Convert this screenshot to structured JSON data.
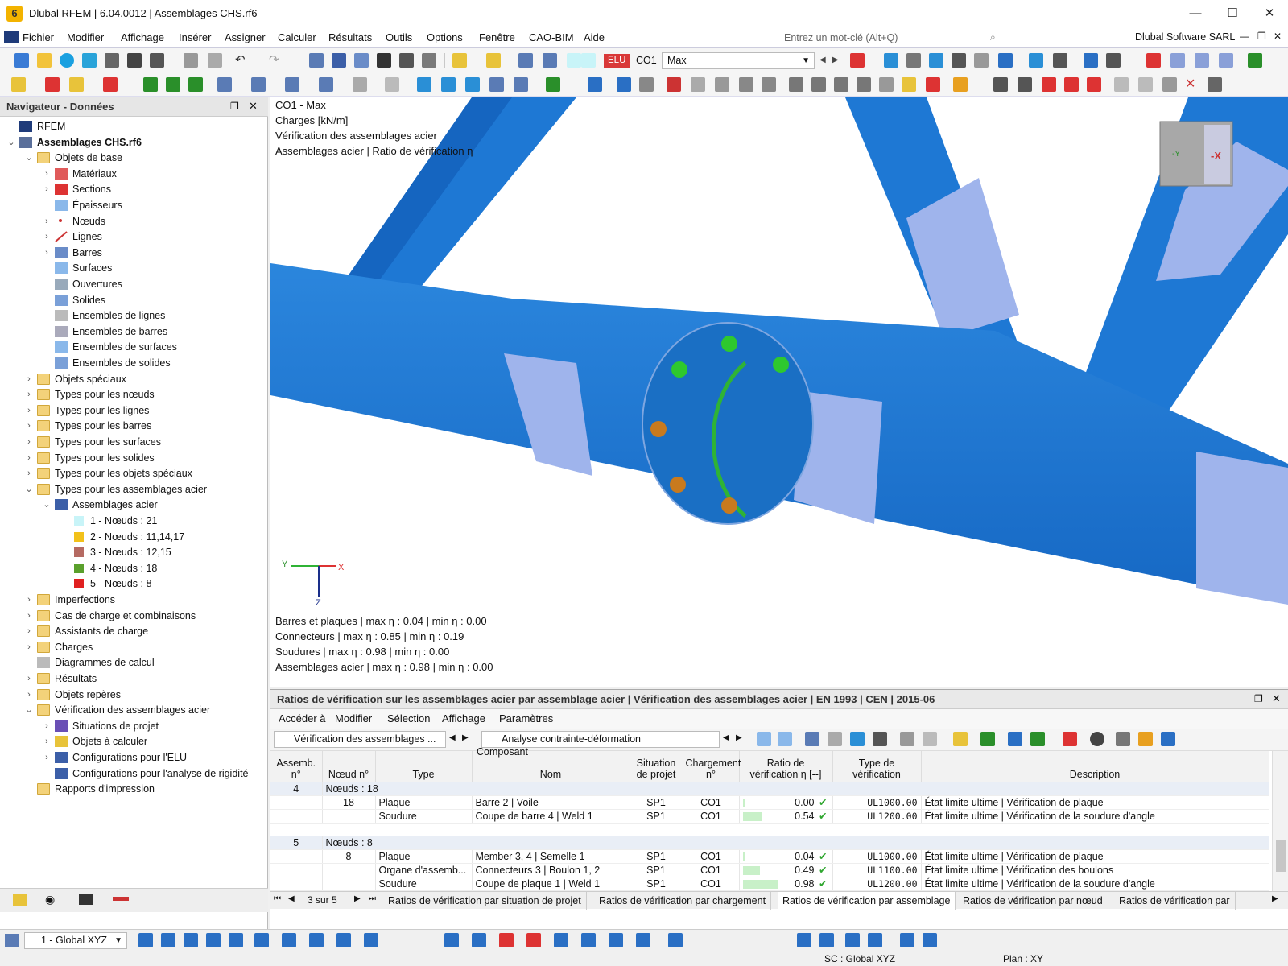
{
  "window": {
    "title": "Dlubal RFEM | 6.04.0012 | Assemblages CHS.rf6",
    "minimize": "—",
    "maximize": "☐",
    "close": "✕"
  },
  "menu": {
    "items": [
      "Fichier",
      "Modifier",
      "Affichage",
      "Insérer",
      "Assigner",
      "Calculer",
      "Résultats",
      "Outils",
      "Options",
      "Fenêtre",
      "CAO-BIM",
      "Aide"
    ],
    "search_placeholder": "Entrez un mot-clé (Alt+Q)",
    "company": "Dlubal Software SARL"
  },
  "toolbar": {
    "elu_badge": "ELU",
    "co_label": "CO1",
    "combo_value": "Max"
  },
  "navigator": {
    "title": "Navigateur - Données",
    "items": [
      {
        "label": "RFEM",
        "level": 0,
        "arrow": "",
        "icon": "rfem-icon"
      },
      {
        "label": "Assemblages CHS.rf6",
        "level": 0,
        "arrow": "▾",
        "icon": "model-icon",
        "bold": true
      },
      {
        "label": "Objets de base",
        "level": 1,
        "arrow": "▾",
        "icon": "folder-icon"
      },
      {
        "label": "Matériaux",
        "level": 2,
        "arrow": "›",
        "icon": "materials-icon"
      },
      {
        "label": "Sections",
        "level": 2,
        "arrow": "›",
        "icon": "sections-icon"
      },
      {
        "label": "Épaisseurs",
        "level": 2,
        "arrow": "",
        "icon": "thickness-icon"
      },
      {
        "label": "Nœuds",
        "level": 2,
        "arrow": "›",
        "icon": "node-icon"
      },
      {
        "label": "Lignes",
        "level": 2,
        "arrow": "›",
        "icon": "line-icon"
      },
      {
        "label": "Barres",
        "level": 2,
        "arrow": "›",
        "icon": "member-icon"
      },
      {
        "label": "Surfaces",
        "level": 2,
        "arrow": "",
        "icon": "surface-icon"
      },
      {
        "label": "Ouvertures",
        "level": 2,
        "arrow": "",
        "icon": "opening-icon"
      },
      {
        "label": "Solides",
        "level": 2,
        "arrow": "",
        "icon": "solid-icon"
      },
      {
        "label": "Ensembles de lignes",
        "level": 2,
        "arrow": "",
        "icon": "line-set-icon"
      },
      {
        "label": "Ensembles de barres",
        "level": 2,
        "arrow": "",
        "icon": "member-set-icon"
      },
      {
        "label": "Ensembles de surfaces",
        "level": 2,
        "arrow": "",
        "icon": "surface-set-icon"
      },
      {
        "label": "Ensembles de solides",
        "level": 2,
        "arrow": "",
        "icon": "solid-set-icon"
      },
      {
        "label": "Objets spéciaux",
        "level": 1,
        "arrow": "›",
        "icon": "folder-icon"
      },
      {
        "label": "Types pour les nœuds",
        "level": 1,
        "arrow": "›",
        "icon": "folder-icon"
      },
      {
        "label": "Types pour les lignes",
        "level": 1,
        "arrow": "›",
        "icon": "folder-icon"
      },
      {
        "label": "Types pour les barres",
        "level": 1,
        "arrow": "›",
        "icon": "folder-icon"
      },
      {
        "label": "Types pour les surfaces",
        "level": 1,
        "arrow": "›",
        "icon": "folder-icon"
      },
      {
        "label": "Types pour les solides",
        "level": 1,
        "arrow": "›",
        "icon": "folder-icon"
      },
      {
        "label": "Types pour les objets spéciaux",
        "level": 1,
        "arrow": "›",
        "icon": "folder-icon"
      },
      {
        "label": "Types pour les assemblages acier",
        "level": 1,
        "arrow": "▾",
        "icon": "folder-icon"
      },
      {
        "label": "Assemblages acier",
        "level": 2,
        "arrow": "▾",
        "icon": "steel-joint-icon"
      },
      {
        "label": "1 - Nœuds : 21",
        "level": 3,
        "arrow": "",
        "icon": "swatch",
        "color": "#c8f4f8"
      },
      {
        "label": "2 - Nœuds : 11,14,17",
        "level": 3,
        "arrow": "",
        "icon": "swatch",
        "color": "#f2c11a"
      },
      {
        "label": "3 - Nœuds : 12,15",
        "level": 3,
        "arrow": "",
        "icon": "swatch",
        "color": "#b56a62"
      },
      {
        "label": "4 - Nœuds : 18",
        "level": 3,
        "arrow": "",
        "icon": "swatch",
        "color": "#5aa02c"
      },
      {
        "label": "5 - Nœuds : 8",
        "level": 3,
        "arrow": "",
        "icon": "swatch",
        "color": "#e02020"
      },
      {
        "label": "Imperfections",
        "level": 1,
        "arrow": "›",
        "icon": "folder-icon"
      },
      {
        "label": "Cas de charge et combinaisons",
        "level": 1,
        "arrow": "›",
        "icon": "folder-icon"
      },
      {
        "label": "Assistants de charge",
        "level": 1,
        "arrow": "›",
        "icon": "folder-icon"
      },
      {
        "label": "Charges",
        "level": 1,
        "arrow": "›",
        "icon": "folder-icon"
      },
      {
        "label": "Diagrammes de calcul",
        "level": 1,
        "arrow": "",
        "icon": "diagram-icon"
      },
      {
        "label": "Résultats",
        "level": 1,
        "arrow": "›",
        "icon": "folder-icon"
      },
      {
        "label": "Objets repères",
        "level": 1,
        "arrow": "›",
        "icon": "folder-icon"
      },
      {
        "label": "Vérification des assemblages acier",
        "level": 1,
        "arrow": "▾",
        "icon": "folder-icon"
      },
      {
        "label": "Situations de projet",
        "level": 2,
        "arrow": "›",
        "icon": "design-situation-icon"
      },
      {
        "label": "Objets à calculer",
        "level": 2,
        "arrow": "›",
        "icon": "objects-icon"
      },
      {
        "label": "Configurations pour l'ELU",
        "level": 2,
        "arrow": "›",
        "icon": "config-icon"
      },
      {
        "label": "Configurations pour l'analyse de rigidité",
        "level": 2,
        "arrow": "",
        "icon": "config-icon"
      },
      {
        "label": "Rapports d'impression",
        "level": 1,
        "arrow": "",
        "icon": "folder-icon"
      }
    ]
  },
  "viewport": {
    "info_lines": [
      "CO1 - Max",
      "Charges [kN/m]",
      "Vérification des assemblages acier",
      "Assemblages acier | Ratio de vérification η"
    ],
    "summary_lines": [
      "Barres et plaques | max η : 0.04 | min η : 0.00",
      "Connecteurs | max η : 0.85 | min η : 0.19",
      "Soudures | max η : 0.98 | min η : 0.00",
      "Assemblages acier | max η : 0.98 | min η : 0.00"
    ],
    "axis_y": "Y",
    "axis_x": "X",
    "axis_z": "Z",
    "cube_y": "-Y",
    "cube_x": "-X",
    "colors": {
      "tube": "#1e78d4",
      "tube_light": "#9fb4ec",
      "flange": "#1a6fc4",
      "weld": "#2fb335",
      "bolt_ok": "#2ec82e",
      "bolt_warn": "#c87a1e"
    }
  },
  "table": {
    "title": "Ratios de vérification sur les assemblages acier par assemblage acier | Vérification des assemblages acier | EN 1993 | CEN | 2015-06",
    "menu": [
      "Accéder à",
      "Modifier",
      "Sélection",
      "Affichage",
      "Paramètres"
    ],
    "combo_left": "Vérification des assemblages ...",
    "combo_right": "Analyse contrainte-déformation",
    "headers": {
      "assemb": "Assemb. n°",
      "noeud": "Nœud n°",
      "composant": "Composant",
      "type": "Type",
      "nom": "Nom",
      "situation": "Situation de projet",
      "chargement": "Chargement n°",
      "ratio": "Ratio de vérification η [--]",
      "typeverif": "Type de vérification",
      "description": "Description"
    },
    "groups": [
      {
        "assemb": "4",
        "label": "Nœuds : 18",
        "rows": [
          {
            "noeud": "18",
            "type": "Plaque",
            "nom": "Barre 2 | Voile",
            "situation": "SP1",
            "chargement": "CO1",
            "ratio": "0.00",
            "ratio_value": 0.0,
            "code": "UL1000.00",
            "description": "État limite ultime | Vérification de plaque"
          },
          {
            "noeud": "",
            "type": "Soudure",
            "nom": "Coupe de barre 4 | Weld 1",
            "situation": "SP1",
            "chargement": "CO1",
            "ratio": "0.54",
            "ratio_value": 0.54,
            "code": "UL1200.00",
            "description": "État limite ultime | Vérification de la soudure d'angle"
          }
        ]
      },
      {
        "assemb": "5",
        "label": "Nœuds : 8",
        "rows": [
          {
            "noeud": "8",
            "type": "Plaque",
            "nom": "Member 3, 4 | Semelle 1",
            "situation": "SP1",
            "chargement": "CO1",
            "ratio": "0.04",
            "ratio_value": 0.04,
            "code": "UL1000.00",
            "description": "État limite ultime | Vérification de plaque"
          },
          {
            "noeud": "",
            "type": "Organe d'assemb...",
            "nom": "Connecteurs 3 | Boulon 1, 2",
            "situation": "SP1",
            "chargement": "CO1",
            "ratio": "0.49",
            "ratio_value": 0.49,
            "code": "UL1100.00",
            "description": "État limite ultime | Vérification des boulons"
          },
          {
            "noeud": "",
            "type": "Soudure",
            "nom": "Coupe de plaque 1 | Weld 1",
            "situation": "SP1",
            "chargement": "CO1",
            "ratio": "0.98",
            "ratio_value": 0.98,
            "code": "UL1200.00",
            "description": "État limite ultime | Vérification de la soudure d'angle"
          }
        ]
      }
    ],
    "pager": "3 sur 5",
    "tabs": [
      "Ratios de vérification par situation de projet",
      "Ratios de vérification par chargement",
      "Ratios de vérification par assemblage",
      "Ratios de vérification par nœud",
      "Ratios de vérification par"
    ],
    "active_tab": 2
  },
  "status": {
    "combo": "1 - Global XYZ",
    "sc": "SC : Global XYZ",
    "plan": "Plan : XY"
  }
}
